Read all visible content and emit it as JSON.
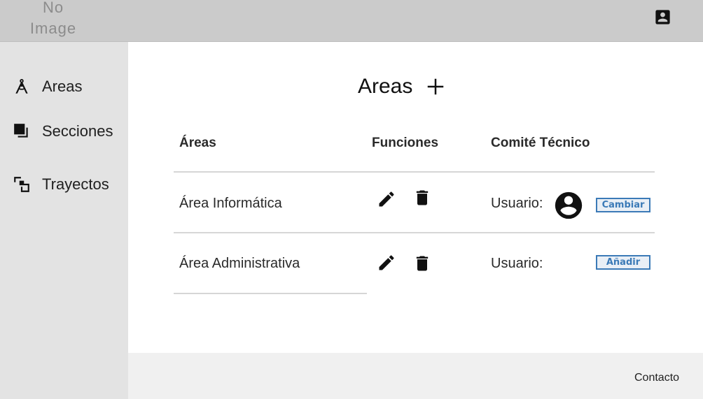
{
  "header": {
    "logo_text_line1": "No",
    "logo_text_line2": "Image",
    "account_icon": "account-box-icon"
  },
  "sidebar": {
    "items": [
      {
        "label": "Areas",
        "icon": "compass-icon"
      },
      {
        "label": "Secciones",
        "icon": "layers-icon"
      },
      {
        "label": "Trayectos",
        "icon": "select-group-icon"
      }
    ]
  },
  "main": {
    "title": "Areas",
    "add_icon": "plus-icon",
    "table": {
      "headers": [
        "Áreas",
        "Funciones",
        "Comité Técnico"
      ],
      "rows": [
        {
          "area": "Área Informática",
          "user_label": "Usuario:",
          "has_user": true,
          "action_label": "Cambiar"
        },
        {
          "area": "Área Administrativa",
          "user_label": "Usuario:",
          "has_user": false,
          "action_label": "Añadir"
        }
      ]
    }
  },
  "footer": {
    "contact_label": "Contacto"
  },
  "colors": {
    "topbar": "#cbcbcb",
    "sidebar": "#e3e3e3",
    "footer": "#f0f0f0",
    "accent": "#3b7ab7"
  }
}
